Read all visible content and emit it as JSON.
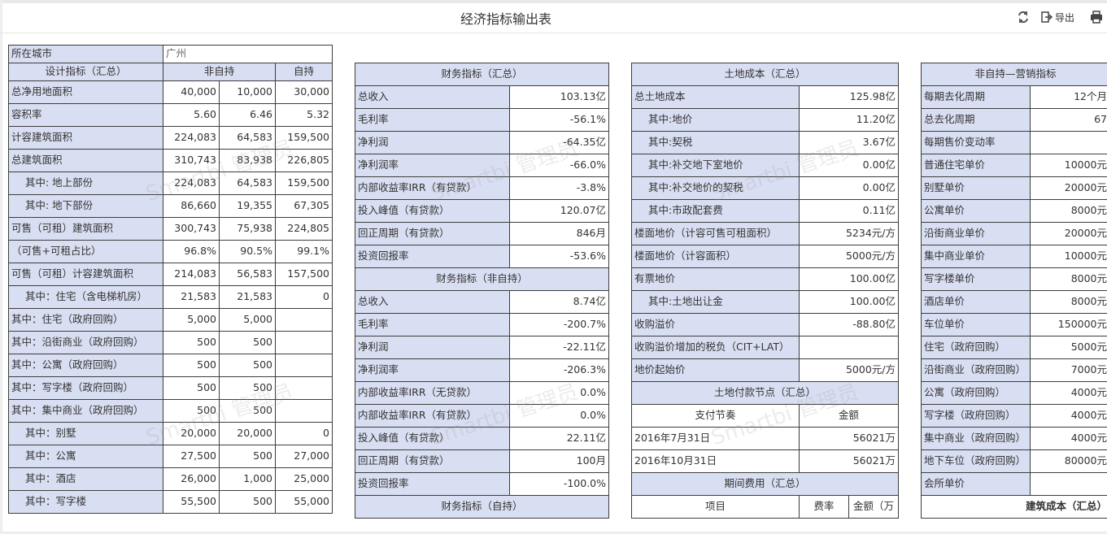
{
  "title": "经济指标输出表",
  "toolbar": {
    "refresh_icon": "refresh-icon",
    "export_label": "导出",
    "print_icon": "print-icon"
  },
  "watermark": "Smartbi 管理员",
  "t1": {
    "city_label": "所在城市",
    "city_value": "广州",
    "headers": [
      "设计指标（汇总）",
      "非自持",
      "自持"
    ],
    "rows": [
      {
        "label": "总净用地面积",
        "ind": false,
        "v": [
          "40,000",
          "10,000",
          "30,000"
        ]
      },
      {
        "label": "容积率",
        "ind": false,
        "v": [
          "5.60",
          "6.46",
          "5.32"
        ]
      },
      {
        "label": "计容建筑面积",
        "ind": false,
        "v": [
          "224,083",
          "64,583",
          "159,500"
        ]
      },
      {
        "label": "总建筑面积",
        "ind": false,
        "v": [
          "310,743",
          "83,938",
          "226,805"
        ]
      },
      {
        "label": "其中: 地上部份",
        "ind": true,
        "v": [
          "224,083",
          "64,583",
          "159,500"
        ]
      },
      {
        "label": "其中: 地下部份",
        "ind": true,
        "v": [
          "86,660",
          "19,355",
          "67,305"
        ]
      },
      {
        "label": "可售（可租）建筑面积",
        "ind": false,
        "v": [
          "300,743",
          "75,938",
          "224,805"
        ]
      },
      {
        "label": "（可售+可租占比）",
        "ind": false,
        "v": [
          "96.8%",
          "90.5%",
          "99.1%"
        ]
      },
      {
        "label": "可售（可租）计容建筑面积",
        "ind": false,
        "v": [
          "214,083",
          "56,583",
          "157,500"
        ]
      },
      {
        "label": "其中：住宅（含电梯机房）",
        "ind": true,
        "v": [
          "21,583",
          "21,583",
          "0"
        ]
      },
      {
        "label": "其中：住宅（政府回购）",
        "ind": false,
        "v": [
          "5,000",
          "5,000",
          ""
        ]
      },
      {
        "label": "其中：沿街商业（政府回购）",
        "ind": false,
        "v": [
          "500",
          "500",
          ""
        ]
      },
      {
        "label": "其中：公寓（政府回购）",
        "ind": false,
        "v": [
          "500",
          "500",
          ""
        ]
      },
      {
        "label": "其中：写字楼（政府回购）",
        "ind": false,
        "v": [
          "500",
          "500",
          ""
        ]
      },
      {
        "label": "其中：集中商业（政府回购）",
        "ind": false,
        "v": [
          "500",
          "500",
          ""
        ]
      },
      {
        "label": "其中：别墅",
        "ind": true,
        "v": [
          "20,000",
          "20,000",
          "0"
        ]
      },
      {
        "label": "其中：公寓",
        "ind": true,
        "v": [
          "27,500",
          "500",
          "27,000"
        ]
      },
      {
        "label": "其中：酒店",
        "ind": true,
        "v": [
          "26,000",
          "1,000",
          "25,000"
        ]
      },
      {
        "label": "其中：写字楼",
        "ind": true,
        "v": [
          "55,500",
          "500",
          "55,000"
        ]
      }
    ]
  },
  "t2": {
    "header1": "财务指标（汇总）",
    "rows1": [
      {
        "label": "总收入",
        "v": "103.13亿"
      },
      {
        "label": "毛利率",
        "v": "-56.1%"
      },
      {
        "label": "净利润",
        "v": "-64.35亿"
      },
      {
        "label": "净利润率",
        "v": "-66.0%"
      },
      {
        "label": "内部收益率IRR（有贷款）",
        "v": "-3.8%"
      },
      {
        "label": "投入峰值（有贷款）",
        "v": "120.07亿"
      },
      {
        "label": "回正周期（有贷款）",
        "v": "846月"
      },
      {
        "label": "投资回报率",
        "v": "-53.6%"
      }
    ],
    "header2": "财务指标（非自持）",
    "rows2": [
      {
        "label": "总收入",
        "v": "8.74亿"
      },
      {
        "label": "毛利率",
        "v": "-200.7%"
      },
      {
        "label": "净利润",
        "v": "-22.11亿"
      },
      {
        "label": "净利润率",
        "v": "-206.3%"
      },
      {
        "label": "内部收益率IRR（无贷款）",
        "v": "0.0%"
      },
      {
        "label": "内部收益率IRR（有贷款）",
        "v": "0.0%"
      },
      {
        "label": "投入峰值（有贷款）",
        "v": "22.11亿"
      },
      {
        "label": "回正周期（有贷款）",
        "v": "100月"
      },
      {
        "label": "投资回报率",
        "v": "-100.0%"
      }
    ],
    "header3": "财务指标（自持）"
  },
  "t3": {
    "header1": "土地成本（汇总）",
    "rows1": [
      {
        "label": "总土地成本",
        "ind": false,
        "v": "125.98亿"
      },
      {
        "label": "其中:地价",
        "ind": true,
        "v": "11.20亿"
      },
      {
        "label": "其中:契税",
        "ind": true,
        "v": "3.67亿"
      },
      {
        "label": "其中:补交地下室地价",
        "ind": true,
        "v": "0.00亿"
      },
      {
        "label": "其中:补交地价的契税",
        "ind": true,
        "v": "0.00亿"
      },
      {
        "label": "其中:市政配套费",
        "ind": true,
        "v": "0.11亿"
      },
      {
        "label": "楼面地价（计容可售可租面积）",
        "ind": false,
        "v": "5234元/方"
      },
      {
        "label": "楼面地价（计容面积）",
        "ind": false,
        "v": "5000元/方"
      },
      {
        "label": "有票地价",
        "ind": false,
        "v": "100.00亿"
      },
      {
        "label": "其中:土地出让金",
        "ind": true,
        "v": "100.00亿"
      },
      {
        "label": "收购溢价",
        "ind": false,
        "v": "-88.80亿"
      },
      {
        "label": "收购溢价增加的税负（CIT+LAT）",
        "ind": false,
        "v": ""
      },
      {
        "label": "地价起始价",
        "ind": false,
        "v": "5000元/方"
      }
    ],
    "header2": "土地付款节点（汇总）",
    "sub2": [
      "支付节奏",
      "金额"
    ],
    "rows2": [
      {
        "date": "2016年7月31日",
        "v": "56021万"
      },
      {
        "date": "2016年10月31日",
        "v": "56021万"
      }
    ],
    "header3": "期间费用（汇总）",
    "sub3": [
      "项目",
      "费率",
      "金额（万"
    ]
  },
  "t4": {
    "header1": "非自持—营销指标",
    "rows1": [
      {
        "label": "每期去化周期",
        "v": "12个月"
      },
      {
        "label": "总去化周期",
        "v": "67"
      },
      {
        "label": "每期售价变动率",
        "v": ""
      },
      {
        "label": "普通住宅单价",
        "v": "10000元"
      },
      {
        "label": "别墅单价",
        "v": "20000元"
      },
      {
        "label": "公寓单价",
        "v": "8000元"
      },
      {
        "label": "沿街商业单价",
        "v": "20000元"
      },
      {
        "label": "集中商业单价",
        "v": "10000元"
      },
      {
        "label": "写字楼单价",
        "v": "8000元"
      },
      {
        "label": "酒店单价",
        "v": "8000元"
      },
      {
        "label": "车位单价",
        "v": "150000元"
      },
      {
        "label": "住宅（政府回购）",
        "v": "5000元"
      },
      {
        "label": "沿街商业（政府回购）",
        "v": "7000元"
      },
      {
        "label": "公寓（政府回购）",
        "v": "4000元"
      },
      {
        "label": "写字楼（政府回购）",
        "v": "4000元"
      },
      {
        "label": "集中商业（政府回购）",
        "v": "4000元"
      },
      {
        "label": "地下车位（政府回购）",
        "v": "80000元"
      },
      {
        "label": "会所单价",
        "v": ""
      }
    ],
    "header2": "建筑成本（汇总）"
  }
}
